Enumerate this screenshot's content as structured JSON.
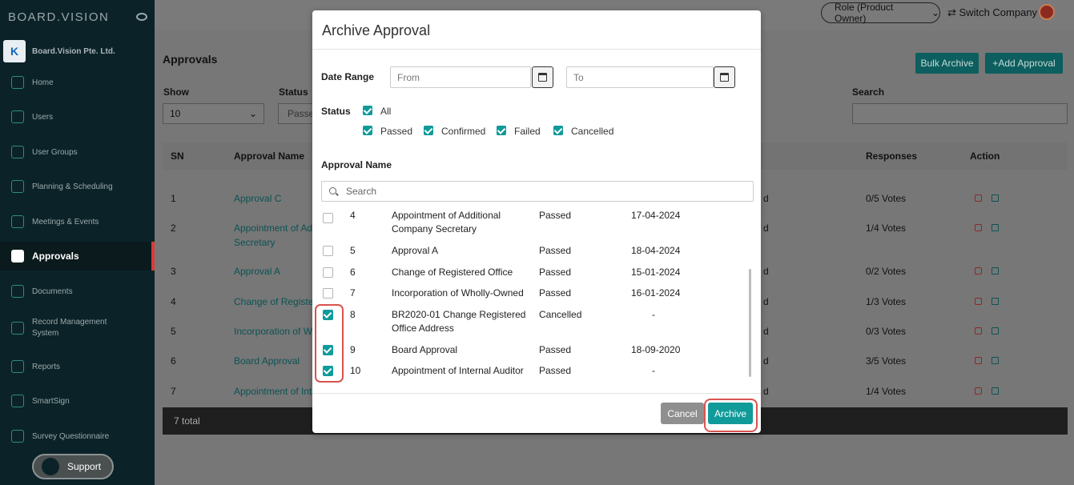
{
  "sidebar": {
    "logo": "BOARD.VISION",
    "company": "Board.Vision Pte. Ltd.",
    "company_initial": "K",
    "items": [
      {
        "label": "Home"
      },
      {
        "label": "Users"
      },
      {
        "label": "User Groups"
      },
      {
        "label": "Planning & Scheduling"
      },
      {
        "label": "Meetings & Events"
      },
      {
        "label": "Approvals"
      },
      {
        "label": "Documents"
      },
      {
        "label": "Record Management System"
      },
      {
        "label": "Reports"
      },
      {
        "label": "SmartSign"
      },
      {
        "label": "Survey Questionnaire"
      }
    ],
    "support_label": "Support"
  },
  "topbar": {
    "role": "Role (Product Owner)",
    "switch_company": "Switch Company"
  },
  "page": {
    "title": "Approvals",
    "bulk_archive": "Bulk Archive",
    "add_approval": "Add Approval",
    "show_label": "Show",
    "show_value": "10",
    "status_label": "Status",
    "status_value": "Passed",
    "search_label": "Search",
    "columns": {
      "sn": "SN",
      "name": "Approval Name",
      "responses": "Responses",
      "action": "Action"
    },
    "rows": [
      {
        "sn": "1",
        "name": "Approval C",
        "tail": "d",
        "responses": "0/5 Votes"
      },
      {
        "sn": "2",
        "name": "Appointment of Addi",
        "name2": "Secretary",
        "tail": "d",
        "responses": "1/4 Votes"
      },
      {
        "sn": "3",
        "name": "Approval A",
        "tail": "d",
        "responses": "0/2 Votes"
      },
      {
        "sn": "4",
        "name": "Change of Register",
        "tail": "d",
        "responses": "1/3 Votes"
      },
      {
        "sn": "5",
        "name": "Incorporation of Wh",
        "tail": "d",
        "responses": "0/3 Votes"
      },
      {
        "sn": "6",
        "name": "Board Approval",
        "tail": "d",
        "responses": "3/5 Votes"
      },
      {
        "sn": "7",
        "name": "Appointment of Inte",
        "tail": "d",
        "responses": "1/4 Votes"
      }
    ],
    "total": "7 total"
  },
  "modal": {
    "title": "Archive Approval",
    "date_range_label": "Date Range",
    "from_placeholder": "From",
    "to_placeholder": "To",
    "status_label": "Status",
    "status_all": "All",
    "statuses": [
      "Passed",
      "Confirmed",
      "Failed",
      "Cancelled"
    ],
    "approval_name_label": "Approval Name",
    "search_placeholder": "Search",
    "items": [
      {
        "checked": false,
        "sn": "4",
        "name": "Appointment of Additional",
        "name2": "Company Secretary",
        "status": "Passed",
        "date": "17-04-2024"
      },
      {
        "checked": false,
        "sn": "5",
        "name": "Approval A",
        "name2": "",
        "status": "Passed",
        "date": "18-04-2024"
      },
      {
        "checked": false,
        "sn": "6",
        "name": "Change of Registered Office",
        "name2": "",
        "status": "Passed",
        "date": "15-01-2024"
      },
      {
        "checked": false,
        "sn": "7",
        "name": "Incorporation of Wholly-Owned",
        "name2": "",
        "status": "Passed",
        "date": "16-01-2024"
      },
      {
        "checked": true,
        "sn": "8",
        "name": "BR2020-01 Change Registered",
        "name2": "Office Address",
        "status": "Cancelled",
        "date": "-"
      },
      {
        "checked": true,
        "sn": "9",
        "name": "Board Approval",
        "name2": "",
        "status": "Passed",
        "date": "18-09-2020"
      },
      {
        "checked": true,
        "sn": "10",
        "name": "Appointment of Internal Auditor",
        "name2": "",
        "status": "Passed",
        "date": "-"
      }
    ],
    "cancel_label": "Cancel",
    "archive_label": "Archive"
  },
  "colors": {
    "accent": "#119a9a",
    "highlight": "#d9534f",
    "sidebar": "#0b2328"
  }
}
